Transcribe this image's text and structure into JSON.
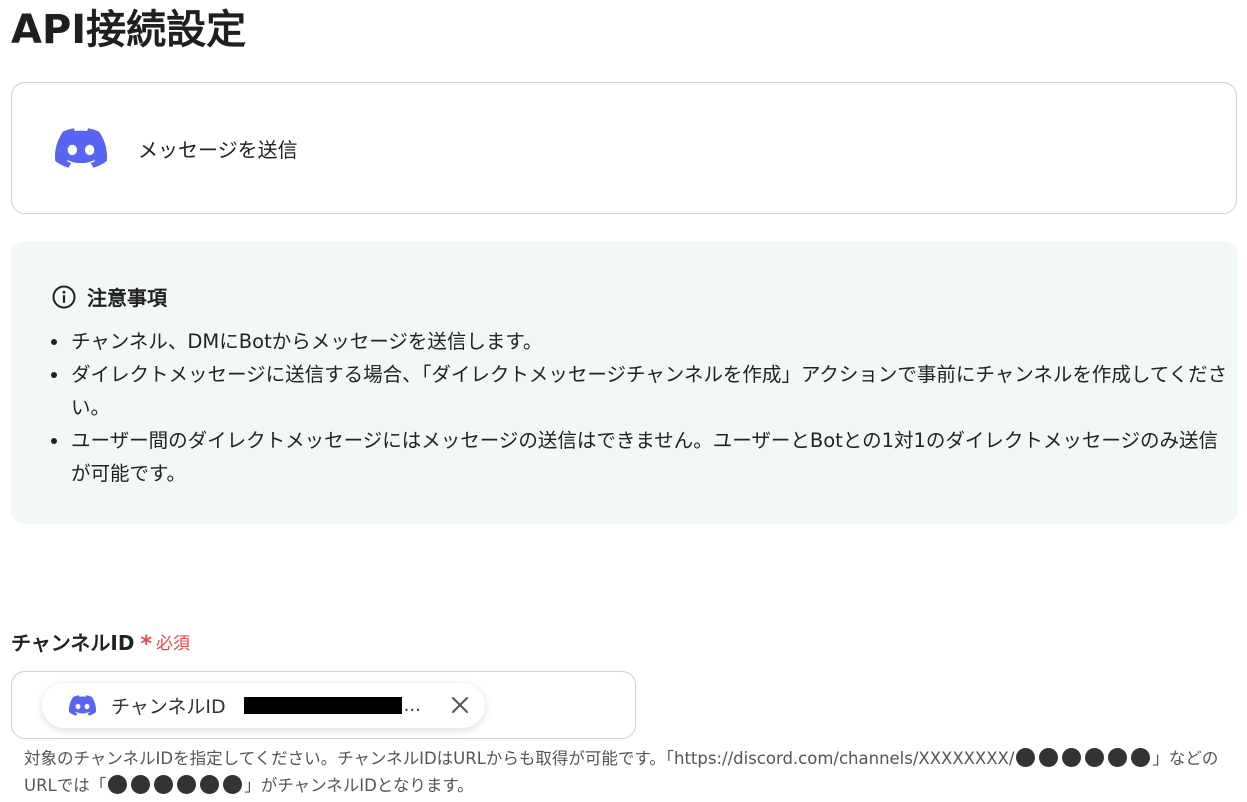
{
  "page": {
    "title": "API接続設定"
  },
  "action": {
    "app_icon": "discord-icon",
    "label": "メッセージを送信",
    "brand_color": "#5865F2"
  },
  "notice": {
    "icon": "info-circle-icon",
    "title": "注意事項",
    "background": "#F1F8F7",
    "items": [
      "チャンネル、DMにBotからメッセージを送信します。",
      "ダイレクトメッセージに送信する場合、「ダイレクトメッセージチャンネルを作成」アクションで事前にチャンネルを作成してください。",
      "ユーザー間のダイレクトメッセージにはメッセージの送信はできません。ユーザーとBotとの1対1のダイレクトメッセージのみ送信が可能です。"
    ]
  },
  "channel_field": {
    "label": "チャンネルID",
    "required_mark": "*",
    "required_text": "必須",
    "required_color": "#E5484D",
    "chip": {
      "icon": "discord-icon",
      "label": "チャンネルID",
      "value_redacted": true,
      "ellipsis": "...",
      "clear_icon": "close-icon"
    },
    "help_text": {
      "part1": "対象のチャンネルIDを指定してください。チャンネルIDはURLからも取得が可能です。「https://discord.com/channels/XXXXXXXX/",
      "part2": "」などのURLでは「",
      "part3": "」がチャンネルIDとなります。"
    }
  }
}
